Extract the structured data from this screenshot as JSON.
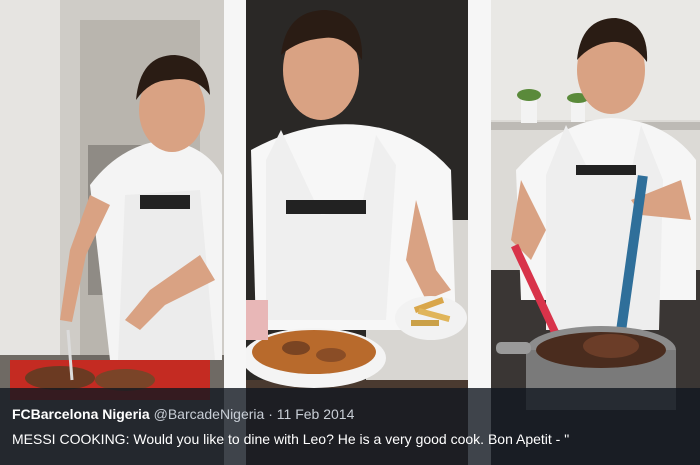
{
  "tweet": {
    "author_name": "FCBarcelona Nigeria",
    "handle": "@BarcadeNigeria",
    "separator": "·",
    "date": "11 Feb 2014",
    "text": "MESSI COOKING: Would you like to dine with Leo? He is a very good cook. Bon Apetit  - \""
  },
  "photos": [
    {
      "scene": "man-cutting-meat-on-red-tray"
    },
    {
      "scene": "man-holding-bowl-and-plate-of-fries"
    },
    {
      "scene": "man-stirring-pot-with-spatulas"
    }
  ],
  "colors": {
    "caption_bg": "#121820",
    "apron": "#f2f2f2",
    "shirt": "#ffffff",
    "skin": "#d9a283",
    "hair": "#2a1c14"
  }
}
